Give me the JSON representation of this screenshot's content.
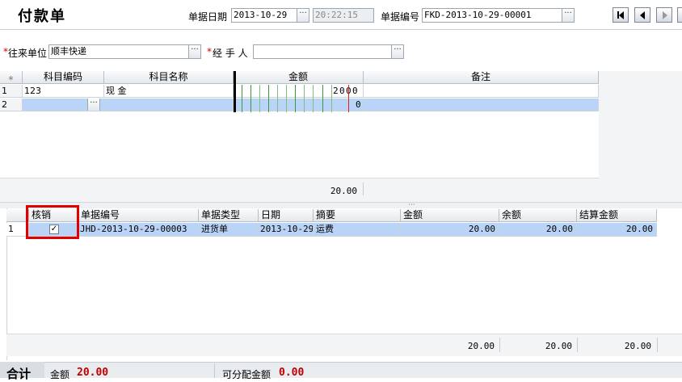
{
  "header": {
    "title": "付款单",
    "date_label": "单据日期",
    "date_value": "2013-10-29",
    "time_value": "20:22:15",
    "docno_label": "单据编号",
    "docno_value": "FKD-2013-10-29-00001",
    "ellipsis": "···"
  },
  "form": {
    "partner_label": "往来单位",
    "partner_value": "顺丰快递",
    "handler_label": "经 手 人",
    "handler_value": "",
    "required_mark": "*"
  },
  "grid1": {
    "corner": "⁎",
    "columns": [
      "科目编码",
      "科目名称",
      "金额",
      "备注"
    ],
    "rows": [
      {
        "no": "1",
        "code": "123",
        "name": "现    金",
        "amount_digits": [
          "2",
          "0",
          "0",
          "0"
        ],
        "note": ""
      },
      {
        "no": "2",
        "code": "",
        "name": "",
        "amount_digits": [
          "0"
        ],
        "note": ""
      }
    ],
    "total": "20.00"
  },
  "grid2": {
    "columns": [
      "核销",
      "单据编号",
      "单据类型",
      "日期",
      "摘要",
      "金额",
      "余额",
      "结算金额"
    ],
    "rows": [
      {
        "no": "1",
        "checked": "✓",
        "doc_no": "JHD-2013-10-29-00003",
        "doc_type": "进货单",
        "date": "2013-10-29",
        "summary": "运费",
        "amount": "20.00",
        "balance": "20.00",
        "settle": "20.00"
      }
    ],
    "totals": {
      "amount": "20.00",
      "balance": "20.00",
      "settle": "20.00"
    }
  },
  "footer": {
    "total_label": "合计",
    "amount_label": "金额",
    "amount_value": "20.00",
    "alloc_label": "可分配金额",
    "alloc_value": "0.00"
  },
  "colors": {
    "selected_row": "#b9d4f7",
    "highlight_box": "#e00000",
    "value_red": "#c00000"
  }
}
